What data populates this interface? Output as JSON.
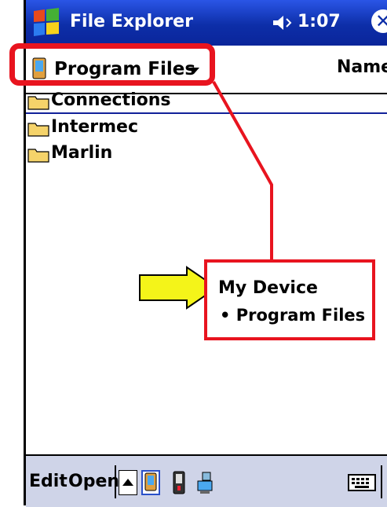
{
  "titlebar": {
    "app_title": "File Explorer",
    "clock": "1:07",
    "close_symbol": "✕",
    "icons": [
      "windows-flag-icon",
      "volume-icon",
      "close-icon"
    ]
  },
  "folderbar": {
    "current_folder": "Program Files",
    "sort_label": "Name"
  },
  "files": [
    {
      "name": "Connections",
      "icon": "folder-icon"
    },
    {
      "name": "Intermec",
      "icon": "folder-icon"
    },
    {
      "name": "Marlin",
      "icon": "folder-icon"
    }
  ],
  "annotation": {
    "menu_items": [
      "My Device",
      "• Program Files"
    ],
    "colors": {
      "box": "#e8141f",
      "arrow": "#f4f419"
    }
  },
  "menubar": {
    "edit_label": "Edit",
    "open_label": "Open",
    "icons": [
      "up-arrow-icon",
      "pocket-pc-icon",
      "storage-card-icon",
      "network-icon",
      "keyboard-icon"
    ]
  },
  "colors": {
    "titlebar": "#0d2ea8",
    "menubar": "#cfd4e8"
  }
}
